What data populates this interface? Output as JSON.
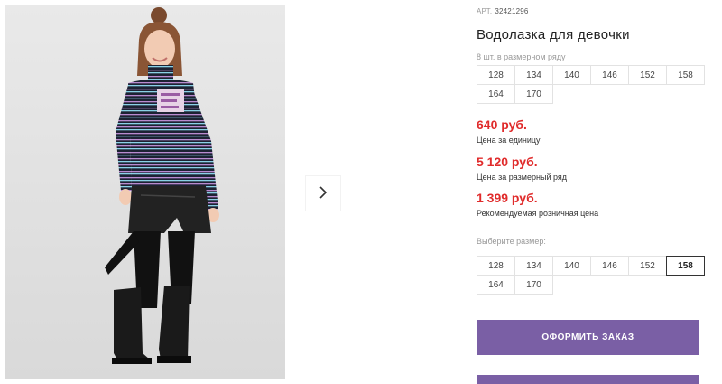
{
  "product": {
    "article_label": "АРТ.",
    "article_value": "32421296",
    "title": "Водолазка для девочки"
  },
  "pack": {
    "caption": "8 шт. в размерном ряду",
    "sizes": [
      "128",
      "134",
      "140",
      "146",
      "152",
      "158",
      "164",
      "170"
    ]
  },
  "prices": [
    {
      "value": "640 руб.",
      "label": "Цена за единицу"
    },
    {
      "value": "5 120 руб.",
      "label": "Цена за размерный ряд"
    },
    {
      "value": "1 399 руб.",
      "label": "Рекомендуемая розничная цена"
    }
  ],
  "size_select": {
    "caption": "Выберите размер:",
    "sizes": [
      "128",
      "134",
      "140",
      "146",
      "152",
      "158",
      "164",
      "170"
    ],
    "selected": "158"
  },
  "actions": {
    "order_label": "ОФОРМИТЬ ЗАКАЗ"
  },
  "gallery": {
    "next_icon": "chevron-right-icon"
  },
  "colors": {
    "accent": "#7a5fa5",
    "price": "#e02b2b"
  }
}
